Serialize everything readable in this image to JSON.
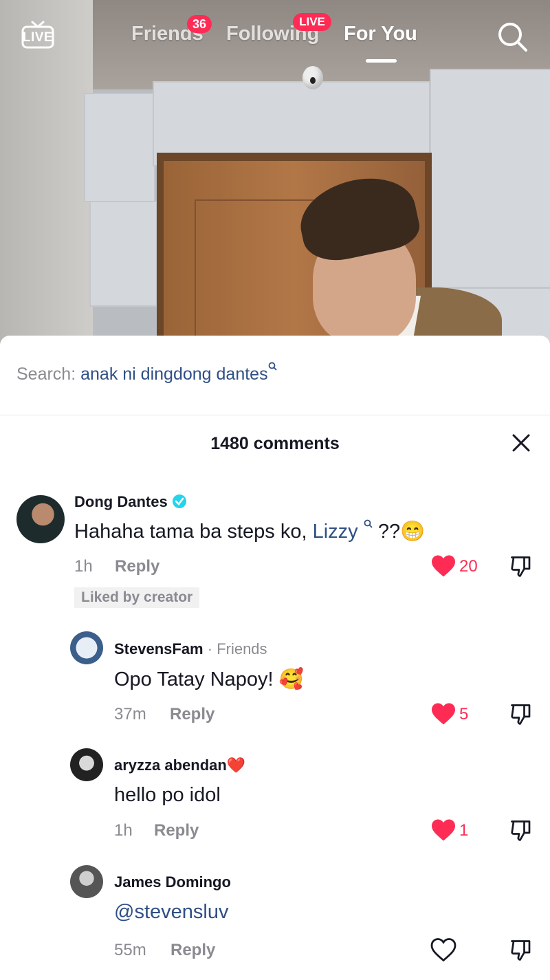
{
  "topnav": {
    "live_label": "LIVE",
    "tabs": [
      {
        "label": "Friends",
        "badge": "36"
      },
      {
        "label": "Following",
        "badge": "LIVE"
      },
      {
        "label": "For You",
        "badge": ""
      }
    ],
    "active_tab": "For You"
  },
  "search": {
    "prefix": "Search:",
    "query": "anak ni dingdong dantes"
  },
  "comments_header": {
    "count_text": "1480 comments"
  },
  "comments": [
    {
      "username": "Dong Dantes",
      "verified": true,
      "text_before": "Hahaha tama ba steps ko, ",
      "mention": "Lizzy",
      "text_after": "??",
      "emoji": "😁",
      "time": "1h",
      "reply_label": "Reply",
      "likes": "20",
      "liked": true,
      "liked_by_creator": "Liked by creator"
    },
    {
      "username": "StevensFam",
      "tag": "· Friends",
      "text": "Opo Tatay Napoy! ",
      "emoji": "🥰",
      "time": "37m",
      "reply_label": "Reply",
      "likes": "5",
      "liked": true
    },
    {
      "username": "aryzza abendan",
      "name_emoji": "❤️",
      "text": "hello po idol",
      "time": "1h",
      "reply_label": "Reply",
      "likes": "1",
      "liked": true
    },
    {
      "username": "James Domingo",
      "text": "@stevensluv",
      "time": "55m",
      "reply_label": "Reply",
      "likes": "",
      "liked": false
    }
  ],
  "colors": {
    "accent_red": "#fe2c55",
    "link_blue": "#2f4f85",
    "muted_gray": "#8a8b91",
    "text_dark": "#161823"
  }
}
